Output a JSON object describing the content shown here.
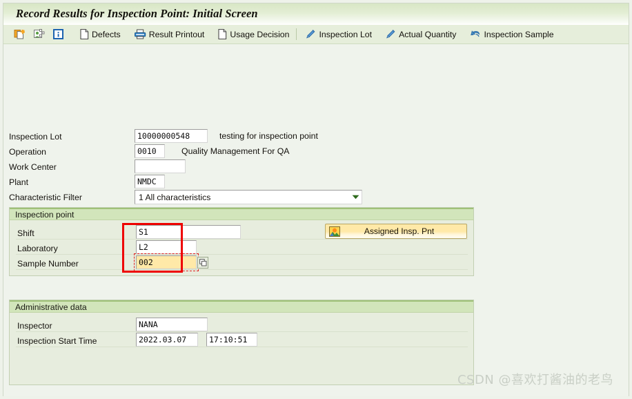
{
  "window": {
    "title": "Record Results for Inspection Point: Initial Screen"
  },
  "toolbar": {
    "items": [
      {
        "icon": "new-document-icon",
        "label": ""
      },
      {
        "icon": "inspection-person-icon",
        "label": ""
      },
      {
        "icon": "info-icon",
        "label": ""
      },
      {
        "icon": "document-icon",
        "label": "Defects"
      },
      {
        "icon": "printer-icon",
        "label": "Result Printout"
      },
      {
        "icon": "document-icon",
        "label": "Usage Decision"
      },
      {
        "icon": "pencil-icon",
        "label": "Inspection Lot"
      },
      {
        "icon": "pencil-icon",
        "label": "Actual Quantity"
      },
      {
        "icon": "undo-icon",
        "label": "Inspection Sample"
      }
    ]
  },
  "form": {
    "inspection_lot": {
      "label": "Inspection Lot",
      "value": "10000000548",
      "description": "testing for inspection point"
    },
    "operation": {
      "label": "Operation",
      "value": "0010",
      "description": "Quality Management For QA"
    },
    "work_center": {
      "label": "Work Center",
      "value": "",
      "placeholder": ""
    },
    "plant": {
      "label": "Plant",
      "value": "NMDC"
    },
    "characteristic_filter": {
      "label": "Characteristic Filter",
      "value": "1 All characteristics",
      "options": [
        "1 All characteristics"
      ]
    }
  },
  "inspection_point": {
    "section_title": "Inspection point",
    "shift": {
      "label": "Shift",
      "value": "S1"
    },
    "laboratory": {
      "label": "Laboratory",
      "value": "L2"
    },
    "sample_number": {
      "label": "Sample Number",
      "value": "002"
    },
    "assigned_button": {
      "label": "Assigned Insp. Pnt",
      "icon": "mountain-sun-icon"
    },
    "matchcode_button": {
      "icon": "multiple-selection-icon"
    }
  },
  "administrative_data": {
    "section_title": "Administrative data",
    "inspector": {
      "label": "Inspector",
      "value": "NANA"
    },
    "start_time": {
      "label": "Inspection Start Time",
      "date": "2022.03.07",
      "time": "17:10:51"
    }
  },
  "watermark": {
    "text": "CSDN @喜欢打酱油的老鸟"
  },
  "colors": {
    "page_background": "#eff3ec",
    "panel_background": "#e7edde",
    "section_header": "#d2e5bb",
    "section_header_border": "#9fc178",
    "title_gradient_top": "#d8e6c5",
    "amber_field": "#ffe9a8",
    "annotation_red": "#ee0000",
    "accent_blue": "#2b6cb0"
  }
}
